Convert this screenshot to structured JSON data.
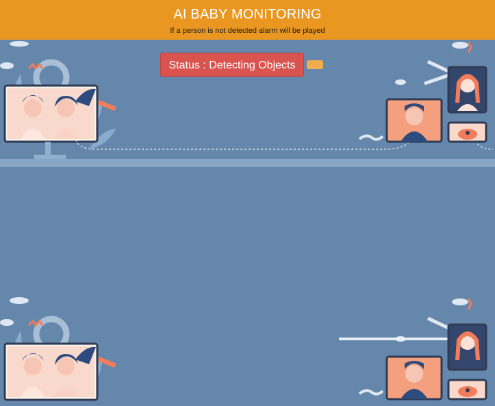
{
  "header": {
    "title": "AI BABY MONITORING",
    "subtitle": "If a person is not detected alarm will be played"
  },
  "status": {
    "label": "Status : Detecting Objects",
    "color": "#d9534f"
  },
  "secondary_button": {
    "label": "",
    "color": "#f0ad4e"
  },
  "colors": {
    "header_bg": "#ea9721",
    "page_bg": "#6587ab",
    "accent_orange": "#f27c5b"
  },
  "illustrations": [
    {
      "name": "video-call-illustration-top"
    },
    {
      "name": "video-call-illustration-bottom"
    }
  ]
}
